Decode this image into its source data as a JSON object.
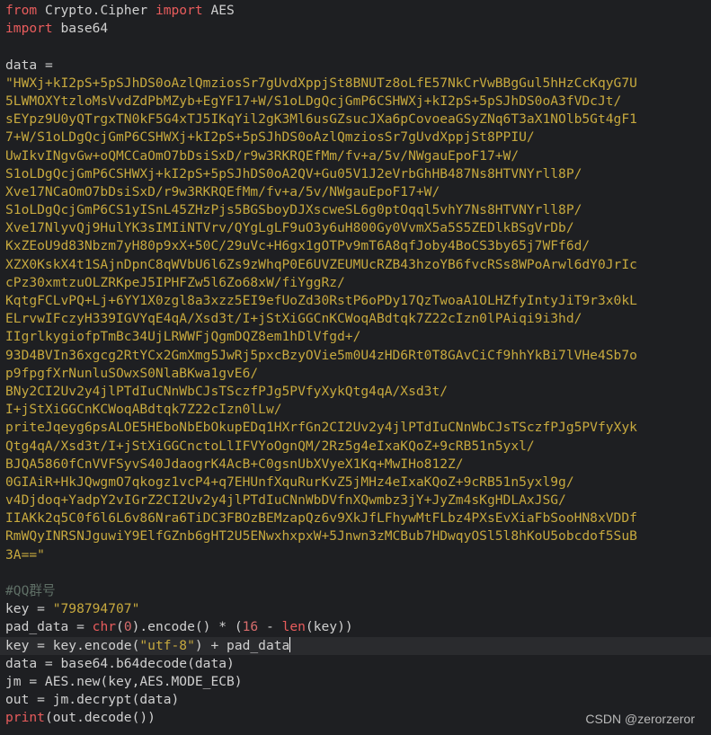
{
  "code": {
    "l1": {
      "kw": "from",
      "mid": " Crypto.Cipher ",
      "kw2": "import",
      "end": " AES"
    },
    "l2": {
      "kw": "import",
      "end": " base64"
    },
    "l4": {
      "var": "data",
      "op": " ="
    },
    "data_lines": [
      "\"HWXj+kI2pS+5pSJhDS0oAzlQmziosSr7gUvdXppjSt8BNUTz8oLfE57NkCrVwBBgGul5hHzCcKqyG7U",
      "5LWMOXYtzloMsVvdZdPbMZyb+EgYF17+W/S1oLDgQcjGmP6CSHWXj+kI2pS+5pSJhDS0oA3fVDcJt/",
      "sEYpz9U0yQTrgxTN0kF5G4xTJ5IKqYil2gK3Ml6usGZsucJXa6pCovoeaGSyZNq6T3aX1NOlb5Gt4gF1",
      "7+W/S1oLDgQcjGmP6CSHWXj+kI2pS+5pSJhDS0oAzlQmziosSr7gUvdXppjSt8PPIU/",
      "UwIkvINgvGw+oQMCCaOmO7bDsiSxD/r9w3RKRQEfMm/fv+a/5v/NWgauEpoF17+W/",
      "S1oLDgQcjGmP6CSHWXj+kI2pS+5pSJhDS0oA2QV+Gu05V1J2eVrbGhHB487Ns8HTVNYrll8P/",
      "Xve17NCaOmO7bDsiSxD/r9w3RKRQEfMm/fv+a/5v/NWgauEpoF17+W/",
      "S1oLDgQcjGmP6CS1yISnL45ZHzPjs5BGSboyDJXscweSL6g0ptOqql5vhY7Ns8HTVNYrll8P/",
      "Xve17NlyvQj9HulYK3sIMIiNTVrv/QYgLgLF9uO3y6uH800Gy0VvmX5a5S5ZEDlkBSgVrDb/",
      "KxZEoU9d83Nbzm7yH80p9xX+50C/29uVc+H6gx1gOTPv9mT6A8qfJoby4BoCS3by65j7WFf6d/",
      "XZX0KskX4t1SAjnDpnC8qWVbU6l6Zs9zWhqP0E6UVZEUMUcRZB43hzoYB6fvcRSs8WPoArwl6dY0JrIc",
      "cPz30xmtzuOLZRKpeJ5IPHFZw5l6Zo68xW/fiYggRz/",
      "KqtgFCLvPQ+Lj+6YY1X0zgl8a3xzz5EI9efUoZd30RstP6oPDy17QzTwoaA1OLHZfyIntyJiT9r3x0kL",
      "ELrvwIFczyH339IGVYqE4qA/Xsd3t/I+jStXiGGCnKCWoqABdtqk7Z22cIzn0lPAiqi9i3hd/",
      "IIgrlkygiofpTmBc34UjLRWWFjQgmDQZ8em1hDlVfgd+/",
      "93D4BVIn36xgcg2RtYCx2GmXmg5JwRj5pxcBzyOVie5m0U4zHD6Rt0T8GAvCiCf9hhYkBi7lVHe4Sb7o",
      "p9fpgfXrNunluSOwxS0NlaBKwa1gvE6/",
      "BNy2CI2Uv2y4jlPTdIuCNnWbCJsTSczfPJg5PVfyXykQtg4qA/Xsd3t/",
      "I+jStXiGGCnKCWoqABdtqk7Z22cIzn0lLw/",
      "priteJqeyg6psALOE5HEboNbEbOkupEDq1HXrfGn2CI2Uv2y4jlPTdIuCNnWbCJsTSczfPJg5PVfyXyk",
      "Qtg4qA/Xsd3t/I+jStXiGGCnctoLlIFVYoOgnQM/2Rz5g4eIxaKQoZ+9cRB51n5yxl/",
      "BJQA5860fCnVVFSyvS40JdaogrK4AcB+C0gsnUbXVyeX1Kq+MwIHo812Z/",
      "0GIAiR+HkJQwgmO7qkogz1vcP4+q7EHUnfXquRurKvZ5jMHz4eIxaKQoZ+9cRB51n5yxl9g/",
      "v4Djdoq+YadpY2vIGrZ2CI2Uv2y4jlPTdIuCNnWbDVfnXQwmbz3jY+JyZm4sKgHDLAxJSG/",
      "IIAKk2q5C0f6l6L6v86Nra6TiDC3FBOzBEMzapQz6v9XkJfLFhywMtFLbz4PXsEvXiaFbSooHN8xVDDf",
      "RmWQyINRSNJguwiY9ElfGZnb6gHT2U5ENwxhxpxW+5Jnwn3zMCBub7HDwqyOSl5l8hKoU5obcdof5SuB",
      "3A==\""
    ],
    "comment": "#QQ群号",
    "key_line": {
      "var": "key",
      "op": " = ",
      "str": "\"798794707\""
    },
    "pad_line": {
      "a": "pad_data",
      "b": " = ",
      "c": "chr",
      "d": "(",
      "e": "0",
      "f": ").encode() * (",
      "g": "16",
      "h": " - ",
      "i": "len",
      "j": "(key))"
    },
    "key_enc_line": {
      "a": "key = key.encode(",
      "str": "\"utf-8\"",
      "b": ") + pad_data"
    },
    "b64_line": "data = base64.b64decode(data)",
    "jm_line": "jm = AES.new(key,AES.MODE_ECB)",
    "out_line": "out = jm.decrypt(data)",
    "print_line": {
      "fn": "print",
      "rest": "(out.decode())"
    }
  },
  "watermark": "CSDN @zerorzeror",
  "colors": {
    "background": "#1e1f22",
    "keyword": "#e85c5c",
    "string": "#c7a93e",
    "number": "#d86d6d",
    "comment": "#5f6f66",
    "text": "#d0d0d0"
  }
}
